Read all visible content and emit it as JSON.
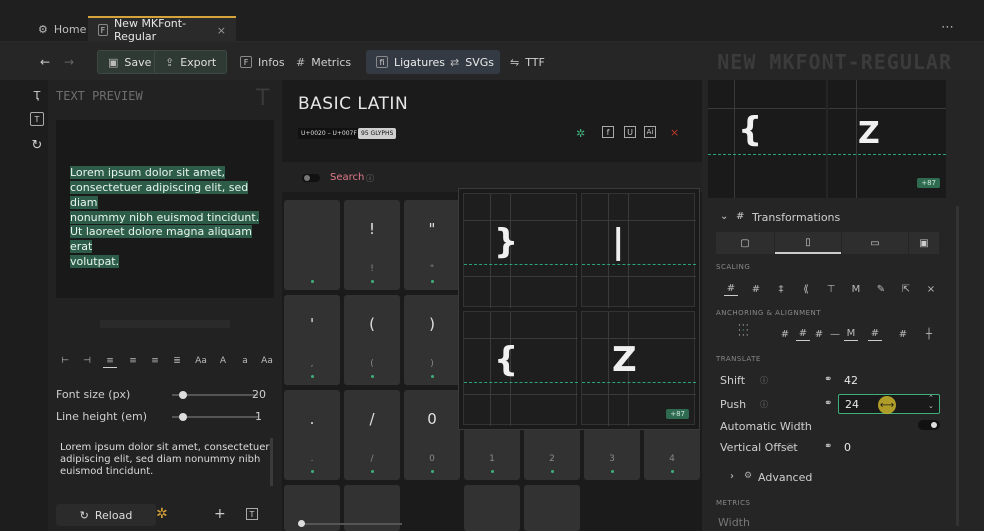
{
  "titlebar": {
    "tabs": [
      {
        "label": "Home",
        "icon": "gear-icon"
      },
      {
        "label": "New MKFont-Regular",
        "icon": "font-file-icon",
        "close": "×"
      }
    ],
    "menu": "⋯"
  },
  "toolbar": {
    "save": "Save",
    "export": "Export",
    "infos": "Infos",
    "metrics": "Metrics",
    "ligatures": "Ligatures",
    "svgs": "SVGs",
    "ttf": "TTF",
    "font_title": "NEW MKFONT-REGULAR"
  },
  "preview": {
    "header": "TEXT PREVIEW",
    "highlight_para1": [
      "Lorem ipsum dolor sit amet,",
      "consectetuer adipiscing elit, sed diam",
      "nonummy nibh euismod tincidunt."
    ],
    "highlight_para2": [
      "Ut laoreet dolore magna aliquam erat",
      "volutpat."
    ],
    "font_size_label": "Font size (px)",
    "font_size_value": "20",
    "font_size_fraction": 0.13,
    "line_height_label": "Line height (em)",
    "line_height_value": "1",
    "line_height_fraction": 0.13,
    "body_text": [
      "Lorem ipsum dolor sit amet, consectetuer",
      "adipiscing elit, sed diam nonummy nibh",
      "euismod tincidunt."
    ],
    "reload": "Reload"
  },
  "block": {
    "title": "BASIC LATIN",
    "range": "U+0020 – U+007F",
    "count": "95 GLYPHS",
    "search": "Search"
  },
  "glyphs": [
    {
      "char": "",
      "sub": ""
    },
    {
      "char": "!",
      "sub": "!"
    },
    {
      "char": "\"",
      "sub": "\""
    },
    {
      "char": "'",
      "sub": ","
    },
    {
      "char": "(",
      "sub": "("
    },
    {
      "char": ")",
      "sub": ")"
    },
    {
      "char": ".",
      "sub": "."
    },
    {
      "char": "/",
      "sub": "/"
    },
    {
      "char": "0",
      "sub": "0"
    },
    {
      "char": "",
      "sub": "1"
    },
    {
      "char": "",
      "sub": "2"
    },
    {
      "char": "",
      "sub": "3"
    },
    {
      "char": "",
      "sub": "4"
    }
  ],
  "popup": {
    "glyphs": [
      "}",
      "|",
      "{",
      "Z"
    ],
    "badge": "+87"
  },
  "right": {
    "top_glyphs": [
      "{",
      "Z"
    ],
    "top_badge": "+87",
    "transformations": "Transformations",
    "scaling": "SCALING",
    "anchoring": "ANCHORING & ALIGNMENT",
    "translate": "TRANSLATE",
    "shift_label": "Shift",
    "shift_value": "42",
    "push_label": "Push",
    "push_value": "24",
    "auto_width_label": "Automatic Width",
    "vertical_offset_label": "Vertical Offset",
    "vertical_offset_value": "0",
    "advanced": "Advanced",
    "metrics": "METRICS",
    "width_label": "Width"
  },
  "colors": {
    "accent": "#2aa37a",
    "highlight": "#2d5d49",
    "tab_accent": "#d6a23a"
  }
}
